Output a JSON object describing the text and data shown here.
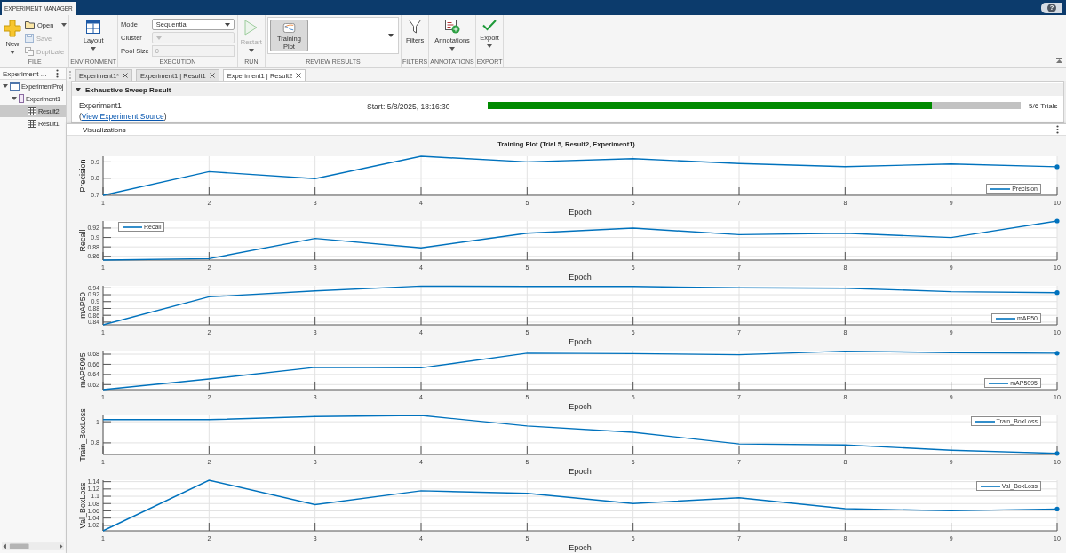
{
  "window": {
    "app_tab": "EXPERIMENT MANAGER",
    "help": "?"
  },
  "toolstrip": [
    {
      "label": "FILE",
      "items": [
        {
          "kind": "large",
          "label": "New",
          "menu": true,
          "disabled": false
        },
        {
          "kind": "stack",
          "buttons": [
            {
              "label": "Open",
              "menu": true,
              "disabled": false
            },
            {
              "label": "Save",
              "menu": false,
              "disabled": true
            },
            {
              "label": "Duplicate",
              "menu": false,
              "disabled": true
            }
          ]
        }
      ]
    },
    {
      "label": "ENVIRONMENT",
      "items": [
        {
          "kind": "large",
          "label": "Layout",
          "menu": true,
          "disabled": false
        }
      ]
    },
    {
      "label": "EXECUTION",
      "items": [
        {
          "kind": "form",
          "fields": [
            {
              "kind": "dropdown",
              "label": "Mode",
              "value": "Sequential",
              "disabled": false
            },
            {
              "kind": "dropdown",
              "label": "Cluster",
              "disabled": true
            },
            {
              "kind": "input",
              "label": "Pool Size",
              "value": "0",
              "disabled": true
            }
          ]
        }
      ]
    },
    {
      "label": "RUN",
      "items": [
        {
          "kind": "large",
          "label": "Restart",
          "menu": true,
          "disabled": true
        }
      ]
    },
    {
      "label": "REVIEW RESULTS",
      "items": [
        {
          "kind": "gallery",
          "tiles": [
            {
              "label": "Training Plot",
              "selected": true
            }
          ]
        }
      ]
    },
    {
      "label": "FILTERS",
      "items": [
        {
          "kind": "large",
          "label": "Filters",
          "menu": false,
          "disabled": false
        }
      ]
    },
    {
      "label": "ANNOTATIONS",
      "items": [
        {
          "kind": "large",
          "label": "Annotations",
          "menu": true,
          "disabled": false
        }
      ]
    },
    {
      "label": "EXPORT",
      "items": [
        {
          "kind": "large",
          "label": "Export",
          "menu": true,
          "disabled": false
        }
      ]
    }
  ],
  "sidebar": {
    "title": "Experiment ...",
    "tree": [
      {
        "label": "ExperimentProj",
        "expanded": true,
        "selected": false,
        "children": [
          {
            "label": "Experiment1",
            "expanded": true,
            "selected": false,
            "children": [
              {
                "label": "Result2",
                "selected": true
              },
              {
                "label": "Result1",
                "selected": false
              }
            ]
          }
        ]
      }
    ]
  },
  "tabs": [
    {
      "label": "Experiment1*",
      "selected": false
    },
    {
      "label": "Experiment1 | Result1",
      "selected": false
    },
    {
      "label": "Experiment1 | Result2",
      "selected": true
    }
  ],
  "result": {
    "title": "Exhaustive Sweep Result",
    "expanded": true,
    "experiment": "Experiment1",
    "source": {
      "before": "(",
      "link": "View Experiment Source",
      "after": ")"
    },
    "start": "Start: 5/8/2025, 18:16:30",
    "progress": {
      "level": 0.833,
      "label": "5/6 Trials"
    }
  },
  "visualizations": {
    "title": "Visualizations",
    "plot_title": "Training Plot (Trial 5, Result2, Experiment1)",
    "charts": [
      {
        "chart_data": {
          "type": "line",
          "xlabel": "Epoch",
          "ylabel": "Precision",
          "x": [
            1,
            2,
            3,
            4,
            5,
            6,
            7,
            8,
            9,
            10
          ],
          "series": [
            {
              "name": "Precision",
              "color": "#0072bd",
              "values": [
                0.695,
                0.84,
                0.797,
                0.935,
                0.9,
                0.92,
                0.89,
                0.871,
                0.887,
                0.87
              ]
            }
          ],
          "xlim": [
            1,
            10
          ],
          "ylim": [
            0.695,
            0.935
          ],
          "xticks": [
            1,
            2,
            3,
            4,
            5,
            6,
            7,
            8,
            9,
            10
          ],
          "yticks": [
            0.7,
            0.8,
            0.9
          ],
          "grid": true
        }
      },
      {
        "chart_data": {
          "type": "line",
          "xlabel": "Epoch",
          "ylabel": "Recall",
          "x": [
            1,
            2,
            3,
            4,
            5,
            6,
            7,
            8,
            9,
            10
          ],
          "series": [
            {
              "name": "Recall",
              "color": "#0072bd",
              "values": [
                0.852,
                0.855,
                0.898,
                0.878,
                0.909,
                0.92,
                0.906,
                0.909,
                0.9,
                0.935
              ]
            }
          ],
          "xlim": [
            1,
            10
          ],
          "ylim": [
            0.852,
            0.935
          ],
          "xticks": [
            1,
            2,
            3,
            4,
            5,
            6,
            7,
            8,
            9,
            10
          ],
          "yticks": [
            0.86,
            0.88,
            0.9,
            0.92
          ],
          "grid": true
        }
      },
      {
        "chart_data": {
          "type": "line",
          "xlabel": "Epoch",
          "ylabel": "mAP50",
          "x": [
            1,
            2,
            3,
            4,
            5,
            6,
            7,
            8,
            9,
            10
          ],
          "series": [
            {
              "name": "mAP50",
              "color": "#0072bd",
              "values": [
                0.832,
                0.914,
                0.931,
                0.945,
                0.944,
                0.944,
                0.94,
                0.939,
                0.929,
                0.926
              ]
            }
          ],
          "xlim": [
            1,
            10
          ],
          "ylim": [
            0.832,
            0.946
          ],
          "xticks": [
            1,
            2,
            3,
            4,
            5,
            6,
            7,
            8,
            9,
            10
          ],
          "yticks": [
            0.84,
            0.86,
            0.88,
            0.9,
            0.92,
            0.94
          ],
          "grid": true
        }
      },
      {
        "chart_data": {
          "type": "line",
          "xlabel": "Epoch",
          "ylabel": "mAP5095",
          "x": [
            1,
            2,
            3,
            4,
            5,
            6,
            7,
            8,
            9,
            10
          ],
          "series": [
            {
              "name": "mAP5095",
              "color": "#0072bd",
              "values": [
                0.61,
                0.631,
                0.654,
                0.653,
                0.682,
                0.681,
                0.679,
                0.686,
                0.683,
                0.682
              ]
            }
          ],
          "xlim": [
            1,
            10
          ],
          "ylim": [
            0.61,
            0.687
          ],
          "xticks": [
            1,
            2,
            3,
            4,
            5,
            6,
            7,
            8,
            9,
            10
          ],
          "yticks": [
            0.62,
            0.64,
            0.66,
            0.68
          ],
          "grid": true
        }
      },
      {
        "chart_data": {
          "type": "line",
          "xlabel": "Epoch",
          "ylabel": "Train_BoxLoss",
          "x": [
            1,
            2,
            3,
            4,
            5,
            6,
            7,
            8,
            9,
            10
          ],
          "series": [
            {
              "name": "Train_BoxLoss",
              "color": "#0072bd",
              "values": [
                1.02,
                1.02,
                1.05,
                1.06,
                0.96,
                0.9,
                0.79,
                0.78,
                0.73,
                0.7
              ]
            }
          ],
          "xlim": [
            1,
            10
          ],
          "ylim": [
            0.69,
            1.06
          ],
          "xticks": [
            1,
            2,
            3,
            4,
            5,
            6,
            7,
            8,
            9,
            10
          ],
          "yticks": [
            0.8,
            1
          ],
          "grid": true
        }
      },
      {
        "chart_data": {
          "type": "line",
          "xlabel": "Epoch",
          "ylabel": "Val_BoxLoss",
          "x": [
            1,
            2,
            3,
            4,
            5,
            6,
            7,
            8,
            9,
            10
          ],
          "series": [
            {
              "name": "Val_BoxLoss",
              "color": "#0072bd",
              "values": [
                1.005,
                1.144,
                1.077,
                1.115,
                1.108,
                1.08,
                1.096,
                1.066,
                1.06,
                1.065
              ]
            }
          ],
          "xlim": [
            1,
            10
          ],
          "ylim": [
            1.005,
            1.144
          ],
          "xticks": [
            1,
            2,
            3,
            4,
            5,
            6,
            7,
            8,
            9,
            10
          ],
          "yticks": [
            1.02,
            1.04,
            1.06,
            1.08,
            1.1,
            1.12,
            1.14
          ],
          "grid": true
        }
      }
    ]
  }
}
